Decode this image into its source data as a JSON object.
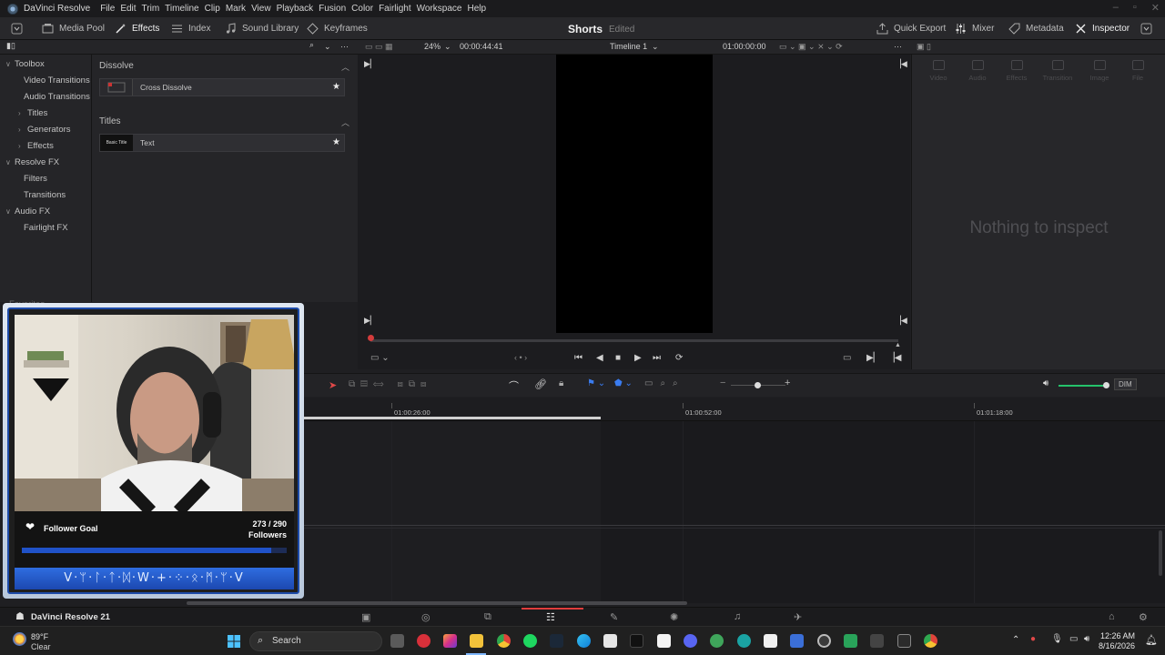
{
  "app": {
    "title": "DaVinci Resolve",
    "menu": [
      "File",
      "Edit",
      "Trim",
      "Timeline",
      "Clip",
      "Mark",
      "View",
      "Playback",
      "Fusion",
      "Color",
      "Fairlight",
      "Workspace",
      "Help"
    ]
  },
  "toolbar": {
    "media_pool": "Media Pool",
    "effects": "Effects",
    "index": "Index",
    "sound_library": "Sound Library",
    "keyframes": "Keyframes",
    "project_name": "Shorts",
    "project_status": "Edited",
    "quick_export": "Quick Export",
    "mixer": "Mixer",
    "metadata": "Metadata",
    "inspector": "Inspector"
  },
  "viewer": {
    "zoom": "24%",
    "duration": "00:00:44:41",
    "timeline_name": "Timeline 1",
    "timecode": "01:00:00:00"
  },
  "effects_panel": {
    "tree": [
      {
        "label": "Toolbox",
        "indent": 0,
        "chevron": "expanded"
      },
      {
        "label": "Video Transitions",
        "indent": 1,
        "chevron": "none"
      },
      {
        "label": "Audio Transitions",
        "indent": 1,
        "chevron": "none"
      },
      {
        "label": "Titles",
        "indent": 1,
        "chevron": "collapsed"
      },
      {
        "label": "Generators",
        "indent": 1,
        "chevron": "collapsed"
      },
      {
        "label": "Effects",
        "indent": 1,
        "chevron": "collapsed"
      },
      {
        "label": "Resolve FX",
        "indent": 0,
        "chevron": "expanded"
      },
      {
        "label": "Filters",
        "indent": 1,
        "chevron": "none"
      },
      {
        "label": "Transitions",
        "indent": 1,
        "chevron": "none"
      },
      {
        "label": "Audio FX",
        "indent": 0,
        "chevron": "expanded"
      },
      {
        "label": "Fairlight FX",
        "indent": 1,
        "chevron": "none"
      }
    ],
    "favorites_label": "Favorites",
    "sections": [
      {
        "title": "Dissolve",
        "items": [
          {
            "name": "Cross Dissolve",
            "thumb": ""
          }
        ]
      },
      {
        "title": "Titles",
        "items": [
          {
            "name": "Text",
            "thumb": "Basic Title"
          }
        ]
      }
    ]
  },
  "inspector": {
    "tabs": [
      "Video",
      "Audio",
      "Effects",
      "Transition",
      "Image",
      "File"
    ],
    "empty_message": "Nothing to inspect"
  },
  "timeline": {
    "ruler_marks": [
      "01:00:26:00",
      "01:00:52:00",
      "01:01:18:00"
    ],
    "dim_label": "DIM"
  },
  "overlay": {
    "goal_label": "Follower Goal",
    "goal_count": "273 / 290",
    "goal_unit": "Followers",
    "goal_current": 273,
    "goal_target": 290,
    "runes": "V·ᛘ·ᛚ·ᛏ·ᛞ·W·+·⁘·ᛟ·ᛗ·ᛘ·V"
  },
  "pagebar": {
    "app_name": "DaVinci Resolve 21",
    "pages": [
      "media-page-icon",
      "cut-page-icon",
      "edit-page-icon",
      "fusion-page-icon",
      "color-page-icon",
      "fairlight-page-icon",
      "deliver-page-icon"
    ],
    "active_page": "edit-page-icon"
  },
  "taskbar": {
    "temperature": "89°F",
    "condition": "Clear",
    "search_placeholder": "Search",
    "time": "12:26 AM",
    "date": "8/16/2026"
  }
}
